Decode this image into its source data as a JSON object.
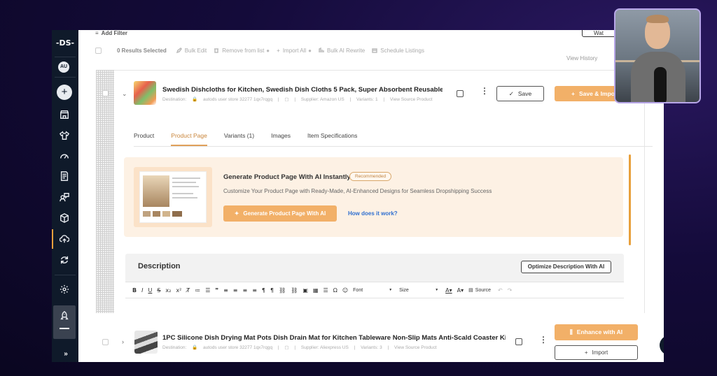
{
  "sidebar": {
    "logo": "-DS-",
    "avatar": "AU",
    "items": [
      "add",
      "store",
      "shirt",
      "speedometer",
      "document",
      "person-chat",
      "package",
      "cloud-upload",
      "refresh",
      "settings",
      "rocket"
    ]
  },
  "topbar": {
    "add_filter": "Add Filter",
    "watch_label": "Wat"
  },
  "toolbar": {
    "selected": "0 Results Selected",
    "bulk_edit": "Bulk Edit",
    "remove_from_list": "Remove from list",
    "import_all": "Import All",
    "bulk_ai_rewrite": "Bulk AI Rewrite",
    "schedule_listings": "Schedule Listings",
    "view_history": "View History"
  },
  "product1": {
    "title": "Swedish Dishcloths for Kitchen, Swedish Dish Cloths 5 Pack, Super Absorbent Reusable Pa...",
    "destination": "Destination:",
    "store": "autods user store 32277 1qx7rqgq",
    "supplier": "Supplier: Amazon US",
    "variants": "Variants: 1",
    "view_source": "View Source Product",
    "save": "Save",
    "save_import": "Save & Impo"
  },
  "tabs": [
    {
      "label": "Product"
    },
    {
      "label": "Product Page"
    },
    {
      "label": "Variants (1)"
    },
    {
      "label": "Images"
    },
    {
      "label": "Item Specifications"
    }
  ],
  "banner": {
    "title": "Generate Product Page With AI Instantly",
    "badge": "Recommended",
    "subtitle": "Customize Your Product Page with Ready-Made, AI-Enhanced Designs for Seamless Dropshipping Success",
    "generate_button": "Generate Product Page With AI",
    "how_link": "How does it work?"
  },
  "description": {
    "title": "Description",
    "optimize_button": "Optimize Description With AI",
    "font_label": "Font",
    "size_label": "Size",
    "source_label": "Source"
  },
  "product2": {
    "title": "1PC Silicone Dish Drying Mat Pots Dish Drain Mat for Kitchen Tableware Non-Slip Mats Anti-Scald Coaster Kitch...",
    "destination": "Destination:",
    "store": "autods user store 32277 1qx7rqgq",
    "supplier": "Supplier: Aliexpress US",
    "variants": "Variants: 3",
    "view_source": "View Source Product",
    "enhance": "Enhance with AI",
    "import": "Import"
  },
  "colors": {
    "accent_orange": "#f2b068",
    "sidebar_bg": "#0f1a2a",
    "link_blue": "#2f6fd0"
  }
}
